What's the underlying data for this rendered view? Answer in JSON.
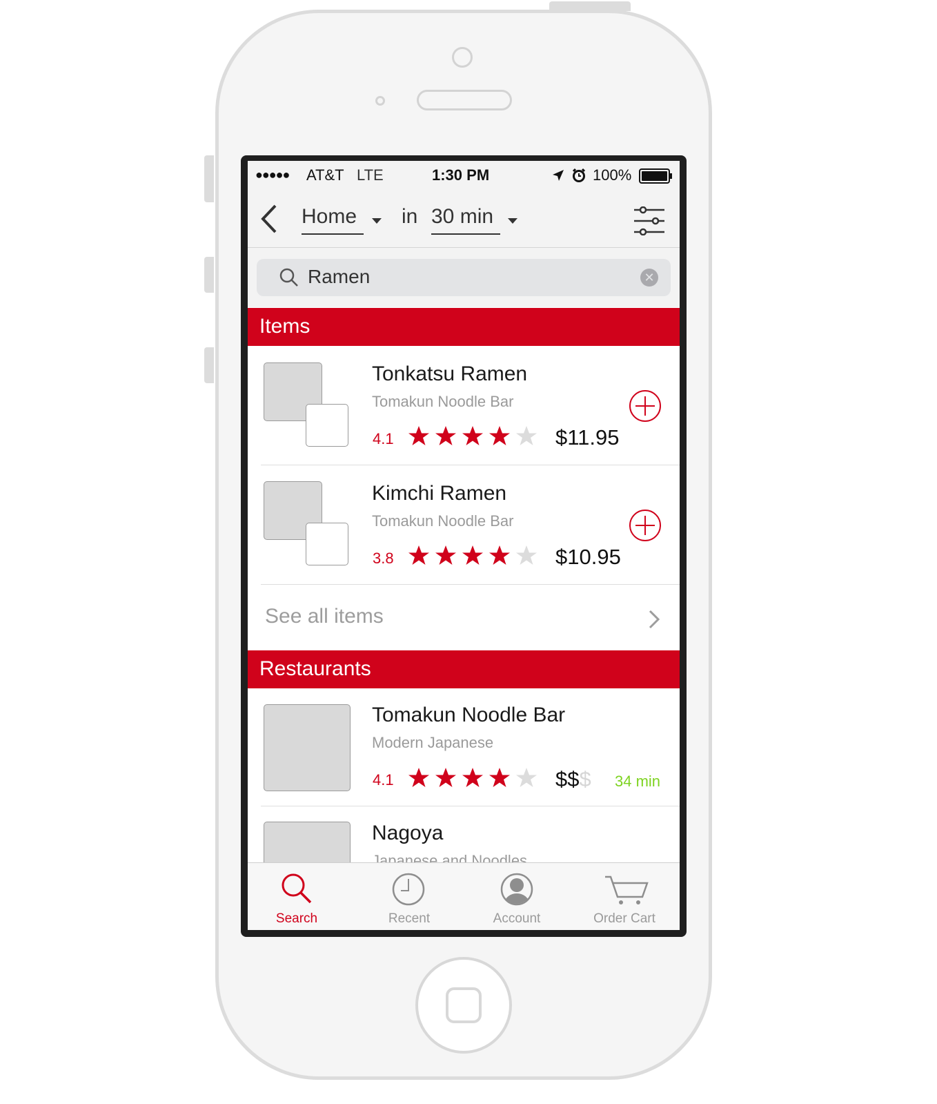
{
  "statusbar": {
    "signal": "●●●●●",
    "carrier": "AT&T",
    "network": "LTE",
    "time": "1:30 PM",
    "battery": "100%"
  },
  "navbar": {
    "location": "Home",
    "in_label": "in",
    "time_option": "30 min"
  },
  "search": {
    "query": "Ramen"
  },
  "items_section": {
    "title": "Items",
    "items": [
      {
        "name": "Tonkatsu Ramen",
        "restaurant": "Tomakun Noodle Bar",
        "rating": "4.1",
        "stars": 4,
        "price": "$11.95"
      },
      {
        "name": "Kimchi Ramen",
        "restaurant": "Tomakun Noodle Bar",
        "rating": "3.8",
        "stars": 4,
        "price": "$10.95"
      }
    ],
    "see_all": "See all items"
  },
  "restaurants_section": {
    "title": "Restaurants",
    "restaurants": [
      {
        "name": "Tomakun Noodle Bar",
        "cuisine": "Modern Japanese",
        "rating": "4.1",
        "stars": 4,
        "price_active": "$$",
        "price_inactive": "$",
        "eta": "34 min"
      },
      {
        "name": "Nagoya",
        "cuisine": "Japanese and Noodles"
      }
    ]
  },
  "tabbar": {
    "tabs": [
      {
        "label": "Search",
        "icon": "search-icon"
      },
      {
        "label": "Recent",
        "icon": "clock-icon"
      },
      {
        "label": "Account",
        "icon": "person-icon"
      },
      {
        "label": "Order Cart",
        "icon": "cart-icon"
      }
    ]
  },
  "colors": {
    "accent": "#d0021b",
    "eta_green": "#7ed321",
    "muted": "#9a9a9a"
  }
}
